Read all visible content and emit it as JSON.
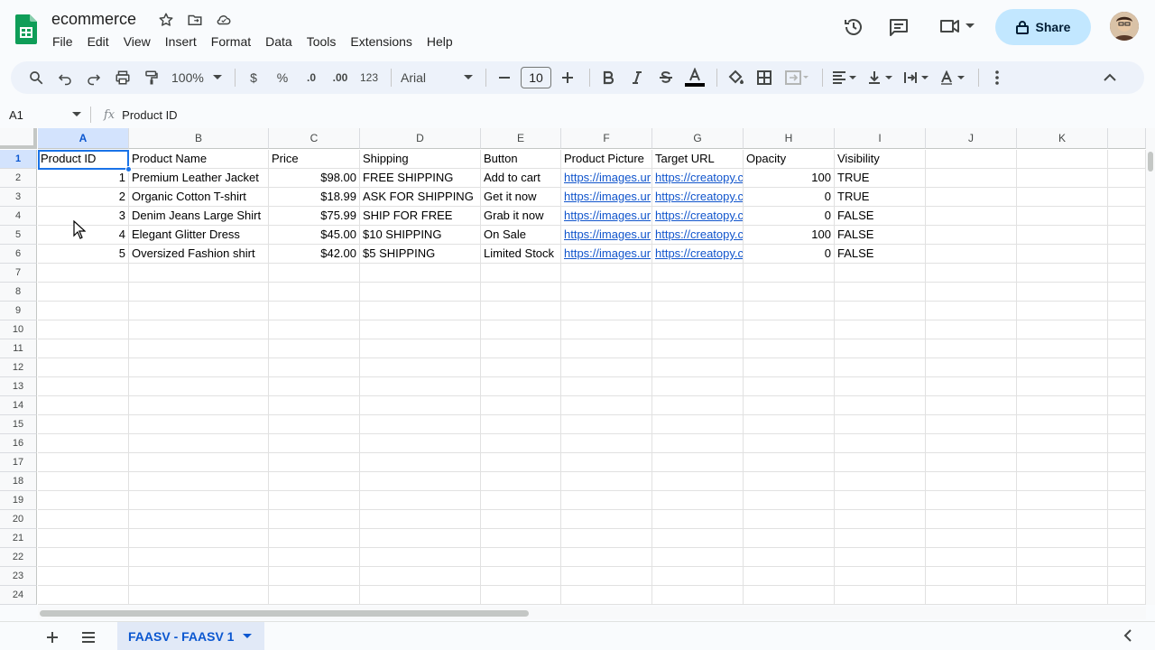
{
  "doc": {
    "title": "ecommerce"
  },
  "menu": [
    "File",
    "Edit",
    "View",
    "Insert",
    "Format",
    "Data",
    "Tools",
    "Extensions",
    "Help"
  ],
  "header": {
    "share_label": "Share"
  },
  "toolbar": {
    "zoom": "100%",
    "currency": "$",
    "percent": "%",
    "dec_decrease": ".0",
    "dec_increase": ".00",
    "number_format": "123",
    "font": "Arial",
    "font_size": "10"
  },
  "formula_bar": {
    "cell_ref": "A1",
    "fx": "fx",
    "content": "Product ID"
  },
  "columns": [
    "A",
    "B",
    "C",
    "D",
    "E",
    "F",
    "G",
    "H",
    "I",
    "J",
    "K"
  ],
  "rows": [
    "1",
    "2",
    "3",
    "4",
    "5",
    "6",
    "7",
    "8",
    "9",
    "10",
    "11",
    "12",
    "13",
    "14",
    "15",
    "16",
    "17",
    "18",
    "19",
    "20",
    "21",
    "22",
    "23",
    "24"
  ],
  "table": [
    [
      "Product ID",
      "Product Name",
      "Price",
      "Shipping",
      "Button",
      "Product Picture",
      "Target URL",
      "Opacity",
      "Visibility"
    ],
    [
      "1",
      "Premium Leather Jacket",
      "$98.00",
      "FREE SHIPPING",
      "Add to cart",
      "https://images.ur",
      "https://creatopy.c",
      "100",
      "TRUE"
    ],
    [
      "2",
      "Organic Cotton T-shirt",
      "$18.99",
      "ASK FOR SHIPPING",
      "Get it now",
      "https://images.ur",
      "https://creatopy.c",
      "0",
      "TRUE"
    ],
    [
      "3",
      "Denim Jeans Large Shirt",
      "$75.99",
      "SHIP FOR FREE",
      "Grab it now",
      "https://images.ur",
      "https://creatopy.c",
      "0",
      "FALSE"
    ],
    [
      "4",
      "Elegant Glitter Dress",
      "$45.00",
      "$10 SHIPPING",
      "On Sale",
      "https://images.ur",
      "https://creatopy.c",
      "100",
      "FALSE"
    ],
    [
      "5",
      "Oversized Fashion shirt",
      "$42.00",
      "$5 SHIPPING",
      "Limited Stock",
      "https://images.ur",
      "https://creatopy.c",
      "0",
      "FALSE"
    ]
  ],
  "sheet_tabs": [
    {
      "label": "FAASV - FAASV 1"
    }
  ],
  "colors": {
    "accent": "#1a73e8",
    "share_bg": "#c2e7ff",
    "link": "#1155cc",
    "tab_active": "#0b57d0"
  }
}
